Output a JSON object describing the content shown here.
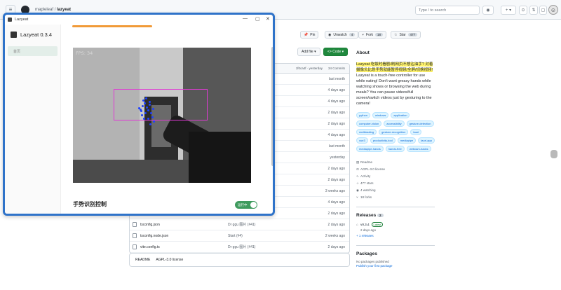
{
  "github": {
    "breadcrumb_user": "mapleleaf",
    "breadcrumb_sep": "/",
    "breadcrumb_repo": "lazyeat",
    "search_placeholder": "Type / to search",
    "plus_label": "+ ▾",
    "actions": {
      "unwatch_label": "Unwatch",
      "unwatch_count": "4",
      "fork_label": "Fork",
      "fork_count": "18",
      "star_label": "Star",
      "star_count": "477"
    },
    "toolbar": {
      "add_file": "Add file ▾",
      "code": "<> Code ▾"
    },
    "file_table": {
      "head_commit": "1f0ca4f · yesterday",
      "commits": "34 Commits",
      "rows": [
        {
          "name": "",
          "msg": "",
          "date": "last month"
        },
        {
          "name": "",
          "msg": "",
          "date": "4 days ago"
        },
        {
          "name": "",
          "msg": "",
          "date": "4 days ago"
        },
        {
          "name": "",
          "msg": "",
          "date": "2 days ago"
        },
        {
          "name": "",
          "msg": "",
          "date": "2 days ago"
        },
        {
          "name": "",
          "msg": "",
          "date": "4 days ago"
        },
        {
          "name": "",
          "msg": "",
          "date": "last month"
        },
        {
          "name": "",
          "msg": "",
          "date": "yesterday"
        },
        {
          "name": "",
          "msg": "",
          "date": "2 days ago"
        },
        {
          "name": "",
          "msg": "",
          "date": "2 days ago"
        },
        {
          "name": "",
          "msg": "",
          "date": "3 weeks ago"
        },
        {
          "name": "",
          "msg": "",
          "date": "4 days ago"
        },
        {
          "name": "",
          "msg": "",
          "date": "2 days ago"
        },
        {
          "name": "tsconfig.json",
          "msg": "Dr ggu 图片 (#41)",
          "date": "2 days ago"
        },
        {
          "name": "tsconfig.node.json",
          "msg": "Start (#4)",
          "date": "2 weeks ago"
        },
        {
          "name": "vite.config.ts",
          "msg": "Dr ggu 图片 (#41)",
          "date": "2 days ago"
        }
      ]
    },
    "readme": {
      "readme_tab": "README",
      "license_tab": "AGPL-3.0 license"
    },
    "about": {
      "title": "About",
      "desc_hl": "Lazyeat 吃饭时看剧/刷网页不想沾油手? 对着摄像头比划手势就能暂停视频/全屏/切换视频!",
      "desc_en": "Lazyeat is a touch-free controller for use while eating! Don't want greasy hands while watching shows or browsing the web during meals? You can pause videos/full screen/switch videos just by gesturing to the camera!",
      "topics": [
        "python",
        "windows",
        "application",
        "computer-vision",
        "accessibility",
        "gesture-detection",
        "multitasking",
        "gesture-recognition",
        "tauri",
        "vue3",
        "productivity-tool",
        "mediapipe",
        "tauri-app",
        "mediapipe-hands",
        "hands-free",
        "webcam-hacks"
      ],
      "readme_link": "Readme",
      "license_link": "AGPL-3.0 license",
      "activity_link": "Activity",
      "stars": "477 stars",
      "watching": "4 watching",
      "forks": "18 forks"
    },
    "releases": {
      "title": "Releases",
      "count": "2",
      "version": "v0.3.4",
      "latest_badge": "Latest",
      "date": "2 days ago",
      "more": "+ 1 releases"
    },
    "packages": {
      "title": "Packages",
      "none": "No packages published",
      "publish_link": "Publish your first package"
    }
  },
  "app": {
    "window_title": "Lazyeat",
    "brand": "Lazyeat 0.3.4",
    "nav_item": "首页",
    "fps_label": "FPS: 34",
    "control_label": "手势识别控制",
    "toggle_label": "运行中"
  },
  "colors": {
    "accent_blue": "#2f73c9",
    "orange_progress": "#f19a38",
    "toggle_green": "#3f9b5e",
    "hand_box": "#e03ad4",
    "code_button": "#1f883d"
  }
}
